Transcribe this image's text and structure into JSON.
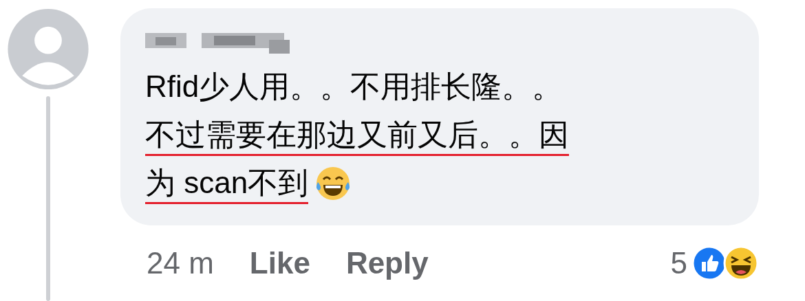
{
  "comment": {
    "lines": [
      {
        "text": "Rfid少人用。。不用排长隆。。",
        "underlined": false
      },
      {
        "text": "不过需要在那边又前又后。。因",
        "underlined": true
      },
      {
        "text": "为 scan不到",
        "underlined": true
      }
    ],
    "time": "24 m",
    "actions": [
      "Like",
      "Reply"
    ],
    "reaction_count": "5"
  }
}
